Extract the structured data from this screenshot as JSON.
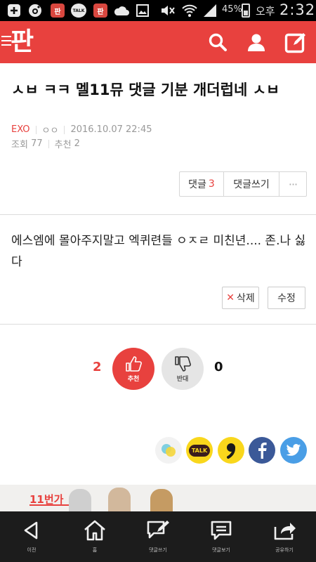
{
  "status_bar": {
    "battery": "45%",
    "ampm": "오후",
    "time": "2:32",
    "talk_label": "TALK",
    "pann_glyph": "판"
  },
  "header": {
    "logo": "판"
  },
  "post": {
    "title": "ㅅㅂ ㅋㅋ 멜11뮤 댓글 기분 개더럽네 ㅅㅂ",
    "category": "EXO",
    "author": "ㅇㅇ",
    "datetime": "2016.10.07 22:45",
    "views_label": "조회",
    "views": "77",
    "recommends_label": "추천",
    "recommends": "2"
  },
  "actions": {
    "comments_label": "댓글",
    "comments_count": "3",
    "write_comment_label": "댓글쓰기",
    "more_label": "···"
  },
  "body": {
    "text": "에스엠에 몰아주지말고 엑퀴련들 ㅇㅈㄹ 미친년.... 존.나 싫다"
  },
  "edit": {
    "delete_label": "삭제",
    "modify_label": "수정"
  },
  "vote": {
    "up_count": "2",
    "up_label": "추천",
    "down_count": "0",
    "down_label": "반대"
  },
  "share": {
    "kakaotalk_label": "TALK"
  },
  "ad": {
    "brand": "11번가"
  },
  "bottom_nav": {
    "back": "이전",
    "home": "홈",
    "write_comment": "댓글쓰기",
    "view_comments": "댓글보기",
    "share": "공유하기"
  },
  "colors": {
    "brand_red": "#e8413e",
    "header_bg": "#e8413e",
    "nav_bg": "#1c1c1c",
    "facebook": "#3b5998",
    "twitter": "#4a9ee6",
    "kakao": "#f9d71c"
  }
}
